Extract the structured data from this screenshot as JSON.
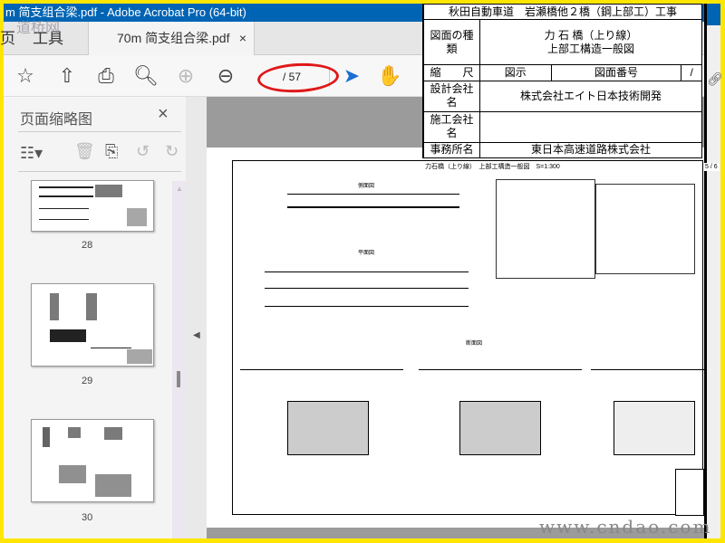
{
  "window": {
    "title": "m 简支组合梁.pdf - Adobe Acrobat Pro (64-bit)",
    "watermark_logo": "道桥网"
  },
  "tabs": {
    "home_partial": "页",
    "tools": "工具",
    "document": "70m 简支组合梁.pdf",
    "close": "×"
  },
  "toolbar": {
    "page_current": "",
    "page_total": "/ 57"
  },
  "left_panel": {
    "title": "页面缩略图",
    "close": "×",
    "thumbnails": [
      {
        "label": "28"
      },
      {
        "label": "29"
      },
      {
        "label": "30"
      }
    ]
  },
  "title_block": {
    "project": "秋田自動車道　岩瀬橋他２橋（鋼上部工）工事",
    "drawing_type_label": "図面の種類",
    "drawing_type_value_1": "力 石 橋（上り線）",
    "drawing_type_value_2": "上部工構造一般図",
    "scale_label": "縮　　尺",
    "scale_value": "図示",
    "number_label": "図面番号",
    "number_value": "/",
    "designer_label": "設計会社名",
    "designer_value": "株式会社エイト日本技術開発",
    "builder_label": "施工会社名",
    "builder_value": "",
    "office_label": "事務所名",
    "office_value": "東日本高速道路株式会社"
  },
  "drawing": {
    "header": "力石橋（上り線）　上部工構造一般図　S=1:300",
    "side_view": "側面図",
    "plan_view": "平面図",
    "section_view": "断面図",
    "page_marker": "5 / 6"
  },
  "footer": {
    "watermark": "www.cndao.com"
  }
}
